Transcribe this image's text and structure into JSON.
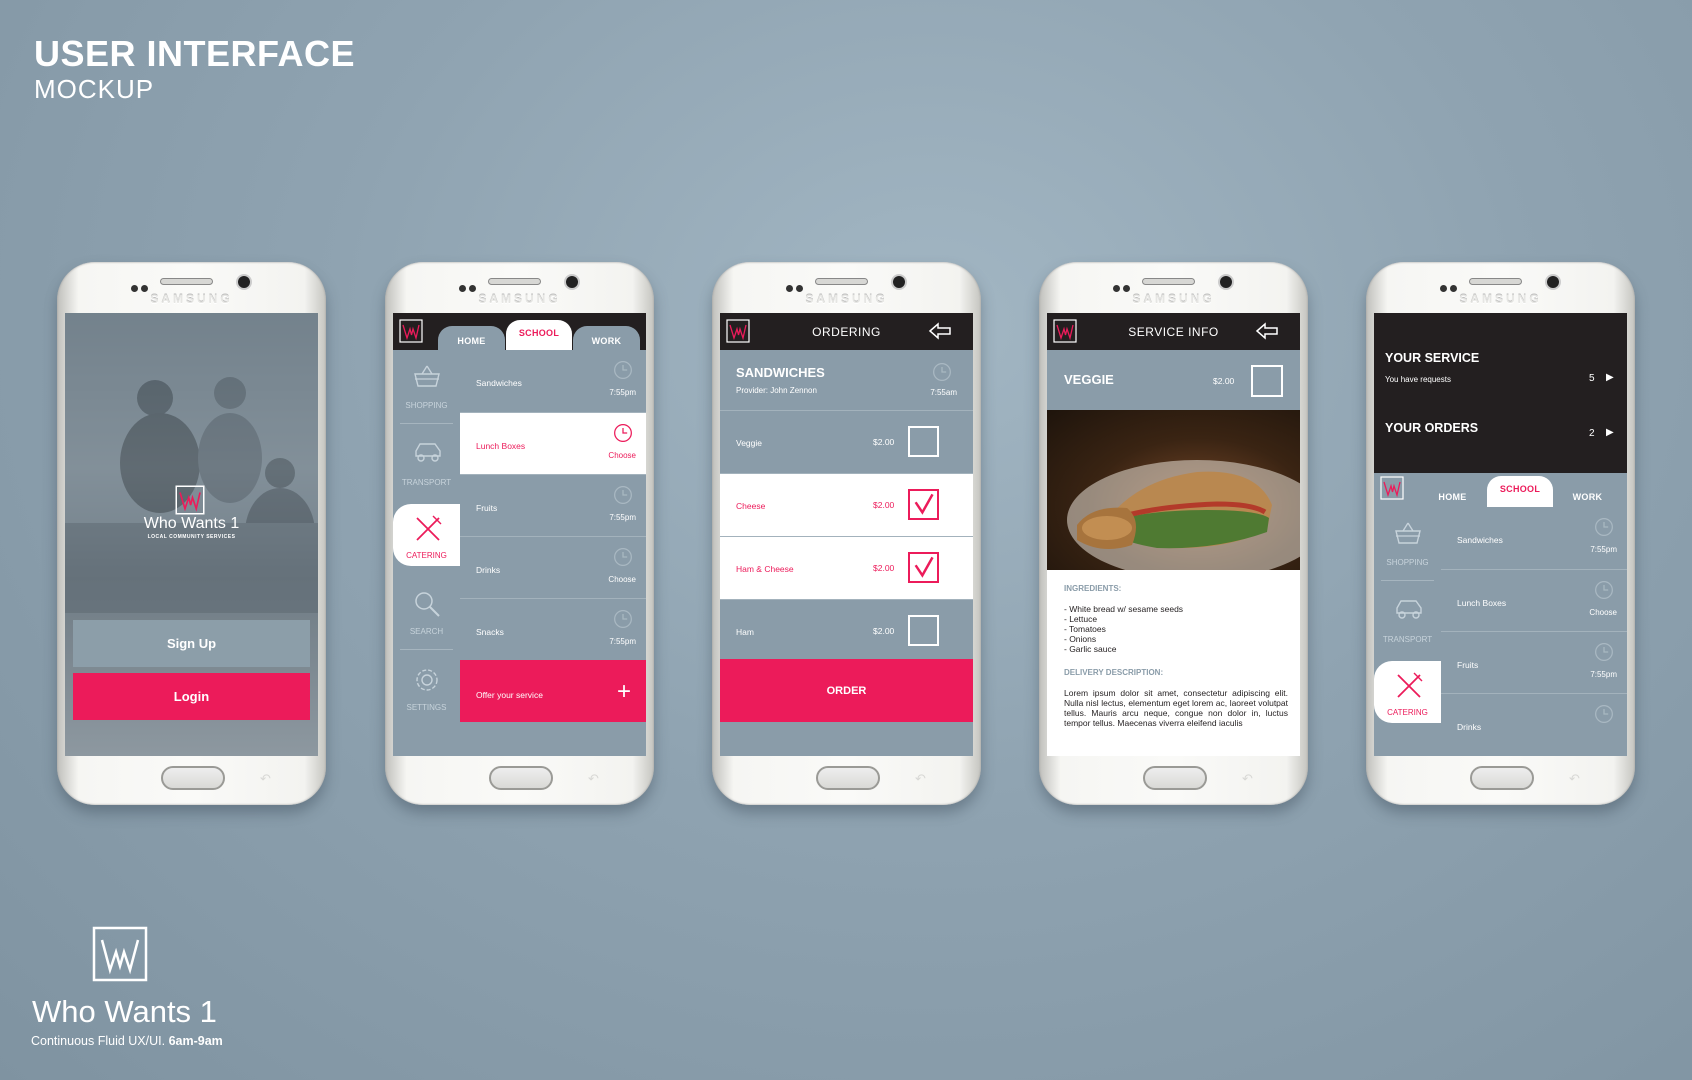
{
  "header": {
    "title": "USER INTERFACE",
    "subtitle": "MOCKUP"
  },
  "brand": {
    "name": "Who Wants 1",
    "tagline": "Continuous Fluid UX/UI.",
    "tagline_bold": "6am-9am",
    "logo_text": "W"
  },
  "colors": {
    "accent": "#ec1b5a",
    "slate": "#8a9ca9",
    "dark": "#231f20",
    "background": "#8fa3b1"
  },
  "phone": {
    "maker": "SAMSUNG"
  },
  "screen_login": {
    "app_name": "Who Wants 1",
    "app_sub": "LOCAL COMMUNITY SERVICES",
    "signup": "Sign Up",
    "login": "Login"
  },
  "tabs": {
    "home": "HOME",
    "school": "SCHOOL",
    "work": "WORK"
  },
  "nav": {
    "shopping": "SHOPPING",
    "transport": "TRANSPORT",
    "catering": "CATERING",
    "search": "SEARCH",
    "settings": "SETTINGS"
  },
  "screen_catalog": {
    "rows": [
      {
        "name": "Sandwiches",
        "time": "7:55pm"
      },
      {
        "name": "Lunch Boxes",
        "time": "Choose"
      },
      {
        "name": "Fruits",
        "time": "7:55pm"
      },
      {
        "name": "Drinks",
        "time": "Choose"
      },
      {
        "name": "Snacks",
        "time": "7:55pm"
      }
    ],
    "offer": "Offer your service",
    "offer_icon": "plus-icon"
  },
  "screen_ordering": {
    "title": "ORDERING",
    "category": "SANDWICHES",
    "provider": "Provider: John Zennon",
    "time": "7:55am",
    "items": [
      {
        "name": "Veggie",
        "price": "$2.00",
        "selected": false
      },
      {
        "name": "Cheese",
        "price": "$2.00",
        "selected": true
      },
      {
        "name": "Ham & Cheese",
        "price": "$2.00",
        "selected": true
      },
      {
        "name": "Ham",
        "price": "$2.00",
        "selected": false
      }
    ],
    "order_button": "ORDER"
  },
  "screen_service": {
    "title": "SERVICE INFO",
    "item": "VEGGIE",
    "price": "$2.00",
    "ingredients_label": "INGREDIENTS:",
    "ingredients": "- White bread w/ sesame seeds\n- Lettuce\n- Tomatoes\n- Onions\n- Garlic sauce",
    "delivery_label": "DELIVERY DESCRIPTION:",
    "delivery_text": "Lorem ipsum dolor sit amet, consectetur adipiscing elit. Nulla nisl lectus, elementum eget lorem ac, laoreet volutpat tellus. Mauris arcu neque, congue non dolor in, luctus tempor tellus. Maecenas viverra eleifend iaculis"
  },
  "screen_dashboard": {
    "your_service": "YOUR SERVICE",
    "requests": "You have requests",
    "service_count": "5",
    "your_orders": "YOUR ORDERS",
    "orders_count": "2",
    "rows": [
      {
        "name": "Sandwiches",
        "time": "7:55pm"
      },
      {
        "name": "Lunch Boxes",
        "time": "Choose"
      },
      {
        "name": "Fruits",
        "time": "7:55pm"
      },
      {
        "name": "Drinks",
        "time": ""
      }
    ]
  }
}
